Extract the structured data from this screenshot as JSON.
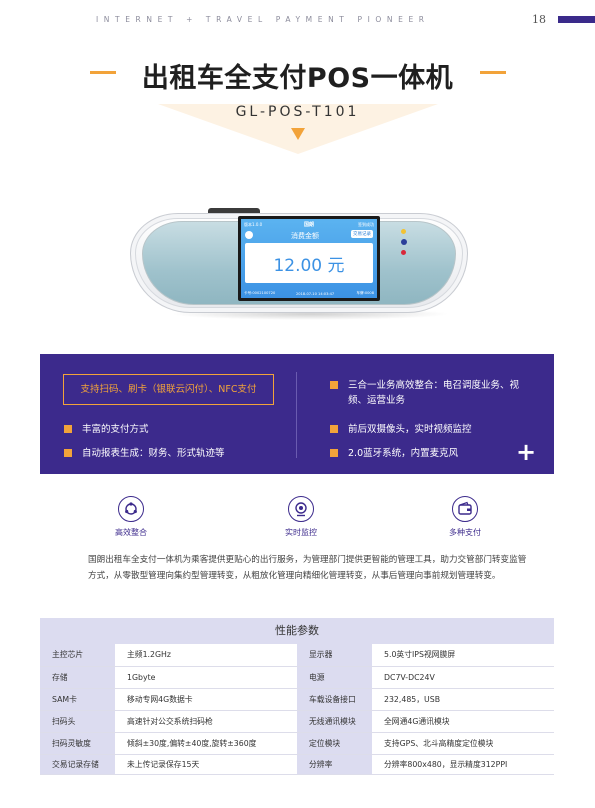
{
  "header": {
    "tagline": "INTERNET + TRAVEL PAYMENT PIONEER",
    "page_number": "18"
  },
  "title": "出租车全支付POS一体机",
  "model": "GL-POS-T101",
  "device_screen": {
    "status_left": "版本1.0.0",
    "brand": "国朗",
    "status_right": "签到成功",
    "amount_label": "消费金额",
    "record_button": "交易记录",
    "amount": "12.00 元",
    "footer_card": "卡号:0002100720",
    "footer_time": "2018-07-10 14:03:47",
    "footer_terminal": "车牌:0008"
  },
  "features": {
    "pay_methods": "支持扫码、刷卡（银联云闪付）、NFC支付",
    "left": [
      "丰富的支付方式",
      "自动报表生成：财务、形式轨迹等"
    ],
    "right": [
      "三合一业务高效整合：电召调度业务、视频、运营业务",
      "前后双摄像头，实时视频监控",
      "2.0蓝牙系统，内置麦克风"
    ],
    "plus": "+"
  },
  "icons": [
    {
      "name": "integration-icon",
      "label": "高效整合"
    },
    {
      "name": "camera-icon",
      "label": "实时监控"
    },
    {
      "name": "wallet-icon",
      "label": "多种支付"
    }
  ],
  "description": "国朗出租车全支付一体机为乘客提供更贴心的出行服务，为管理部门提供更智能的管理工具，助力交管部门转变监管方式，从零散型管理向集约型管理转变，从粗放化管理向精细化管理转变，从事后管理向事前规划管理转变。",
  "spec_table": {
    "title": "性能参数",
    "rows": [
      {
        "k1": "主控芯片",
        "v1": "主频1.2GHz",
        "k2": "显示器",
        "v2": "5.0英寸IPS视网膜屏"
      },
      {
        "k1": "存储",
        "v1": "1Gbyte",
        "k2": "电源",
        "v2": "DC7V-DC24V"
      },
      {
        "k1": "SAM卡",
        "v1": "移动专网4G数据卡",
        "k2": "车载设备接口",
        "v2": "232,485，USB"
      },
      {
        "k1": "扫码头",
        "v1": "高速针对公交系统扫码枪",
        "k2": "无线通讯模块",
        "v2": "全网通4G通讯模块"
      },
      {
        "k1": "扫码灵敏度",
        "v1": "倾斜±30度,偏转±40度,旋转±360度",
        "k2": "定位模块",
        "v2": "支持GPS、北斗高精度定位模块"
      },
      {
        "k1": "交易记录存储",
        "v1": "未上传记录保存15天",
        "k2": "分辨率",
        "v2": "分辨率800x480，显示精度312PPI"
      }
    ]
  },
  "colors": {
    "accent": "#f2a33a",
    "primary": "#3c2a8c",
    "table_header": "#dcdcf0"
  }
}
